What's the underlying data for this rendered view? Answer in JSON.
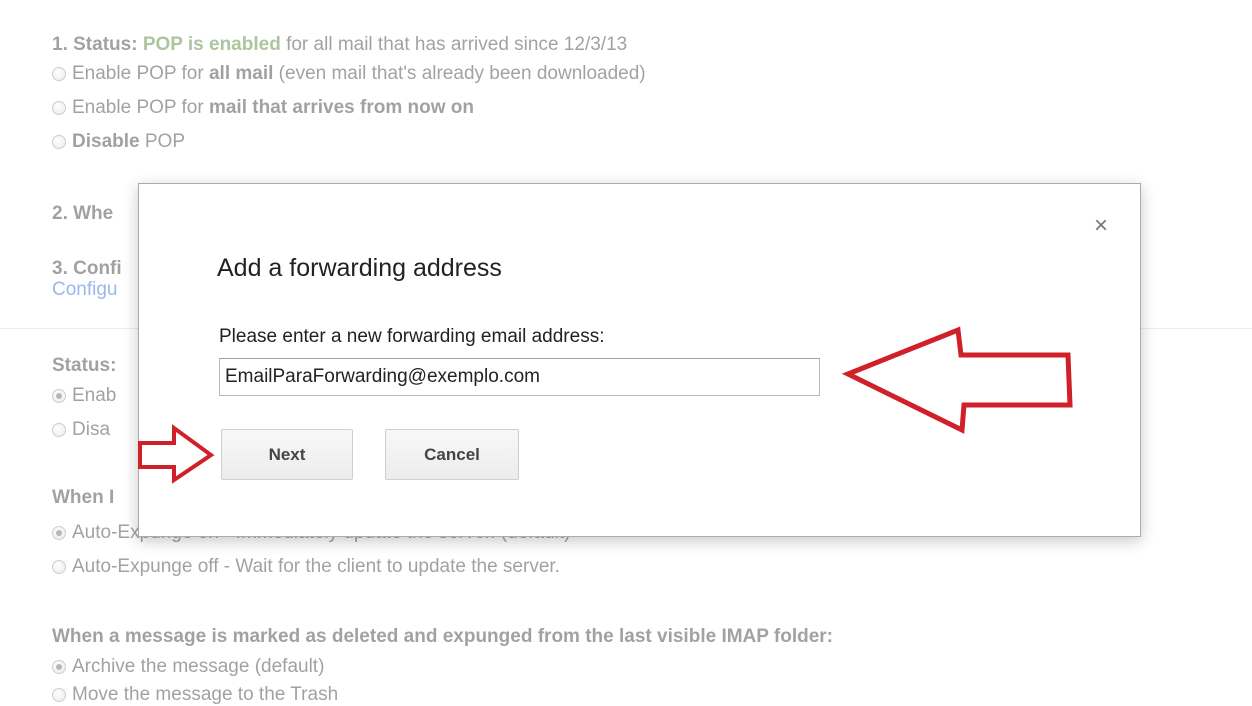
{
  "background": {
    "pop_section": {
      "status_prefix": "1. Status:",
      "status_value": "POP is enabled",
      "status_suffix": "for all mail that has arrived since 12/3/13",
      "option_all_prefix": "Enable POP for",
      "option_all_bold": "all mail",
      "option_all_suffix": "(even mail that's already been downloaded)",
      "option_new_prefix": "Enable POP for",
      "option_new_bold": "mail that arrives from now on",
      "option_disable_bold": "Disable",
      "option_disable_suffix": "POP",
      "step2_partial": "2. Whe",
      "step3_partial": "3. Confi",
      "configure_partial": "Configu"
    },
    "imap_section": {
      "status_partial": "Status:",
      "enable_partial": "Enab",
      "disable_partial": "Disa",
      "when_partial": "When I",
      "auto_on_partial": "Auto-Expunge on - Immediately update the server. (default)",
      "auto_off": "Auto-Expunge off - Wait for the client to update the server.",
      "deleted_heading": "When a message is marked as deleted and expunged from the last visible IMAP folder:",
      "archive_option": "Archive the message (default)",
      "trash_option": "Move the message to the Trash"
    }
  },
  "dialog": {
    "title": "Add a forwarding address",
    "prompt": "Please enter a new forwarding email address:",
    "email_value": "EmailParaForwarding@exemplo.com",
    "next_label": "Next",
    "cancel_label": "Cancel",
    "close_glyph": "×"
  },
  "annotations": {
    "arrow_color": "#d0202a"
  }
}
